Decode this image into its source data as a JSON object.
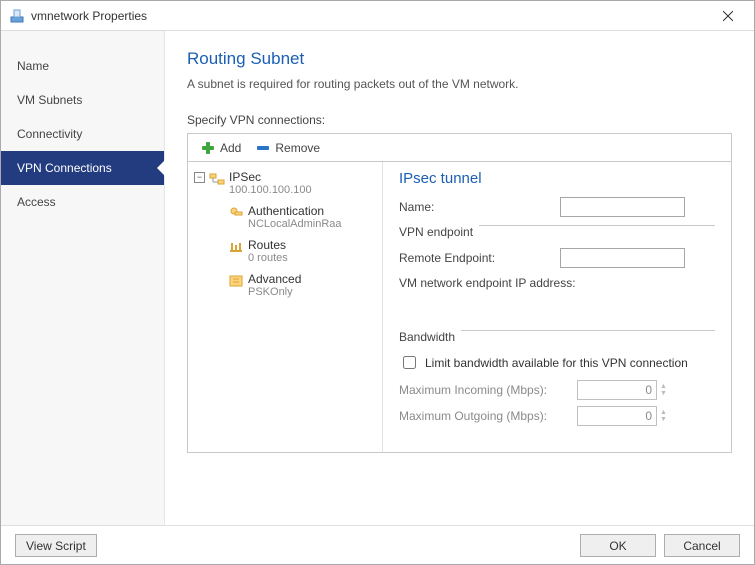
{
  "window": {
    "title": "vmnetwork Properties"
  },
  "sidebar": {
    "items": [
      {
        "label": "Name"
      },
      {
        "label": "VM Subnets"
      },
      {
        "label": "Connectivity"
      },
      {
        "label": "VPN Connections",
        "active": true
      },
      {
        "label": "Access"
      }
    ]
  },
  "page": {
    "title": "Routing Subnet",
    "description": "A subnet is required for routing packets out of the VM network.",
    "specify_label": "Specify VPN connections:"
  },
  "toolbar": {
    "add_label": "Add",
    "remove_label": "Remove"
  },
  "tree": {
    "root": {
      "label": "IPSec",
      "sub": "100.100.100.100"
    },
    "children": [
      {
        "label": "Authentication",
        "sub": "NCLocalAdminRaa"
      },
      {
        "label": "Routes",
        "sub": "0 routes"
      },
      {
        "label": "Advanced",
        "sub": "PSKOnly"
      }
    ]
  },
  "details": {
    "title": "IPsec tunnel",
    "name_label": "Name:",
    "name_value": "",
    "vpn_endpoint_group": "VPN endpoint",
    "remote_endpoint_label": "Remote Endpoint:",
    "remote_endpoint_value": "",
    "vm_endpoint_label": "VM network endpoint IP address:",
    "bandwidth_group": "Bandwidth",
    "limit_checkbox_label": "Limit bandwidth available for this VPN connection",
    "limit_checked": false,
    "max_in_label": "Maximum Incoming (Mbps):",
    "max_in_value": "0",
    "max_out_label": "Maximum Outgoing (Mbps):",
    "max_out_value": "0"
  },
  "footer": {
    "view_script": "View Script",
    "ok": "OK",
    "cancel": "Cancel"
  }
}
